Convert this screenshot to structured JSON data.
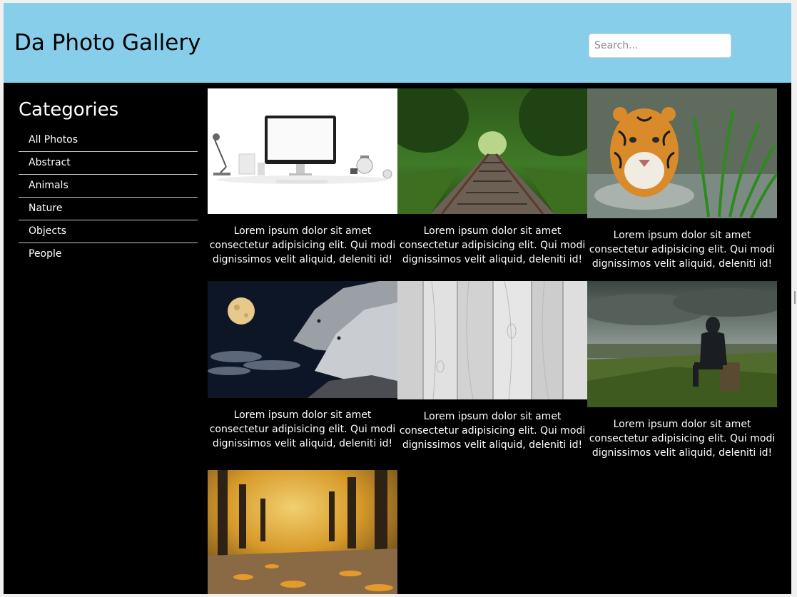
{
  "header": {
    "title": "Da Photo Gallery",
    "search_placeholder": "Search...",
    "background": "#87ceeb"
  },
  "sidebar": {
    "title": "Categories",
    "items": [
      {
        "label": "All Photos"
      },
      {
        "label": "Abstract"
      },
      {
        "label": "Animals"
      },
      {
        "label": "Nature"
      },
      {
        "label": "Objects"
      },
      {
        "label": "People"
      }
    ]
  },
  "gallery": {
    "items": [
      {
        "subject": "desk-computer",
        "caption": "Lorem ipsum dolor sit amet consectetur adipisicing elit. Qui modi dignissimos velit aliquid, deleniti id!"
      },
      {
        "subject": "railway-track",
        "caption": "Lorem ipsum dolor sit amet consectetur adipisicing elit. Qui modi dignissimos velit aliquid, deleniti id!"
      },
      {
        "subject": "tiger",
        "caption": "Lorem ipsum dolor sit amet consectetur adipisicing elit. Qui modi dignissimos velit aliquid, deleniti id!"
      },
      {
        "subject": "wolves-moon",
        "caption": "Lorem ipsum dolor sit amet consectetur adipisicing elit. Qui modi dignissimos velit aliquid, deleniti id!"
      },
      {
        "subject": "white-wood",
        "caption": "Lorem ipsum dolor sit amet consectetur adipisicing elit. Qui modi dignissimos velit aliquid, deleniti id!"
      },
      {
        "subject": "person-landscape",
        "caption": "Lorem ipsum dolor sit amet consectetur adipisicing elit. Qui modi dignissimos velit aliquid, deleniti id!"
      },
      {
        "subject": "autumn-path"
      }
    ]
  }
}
